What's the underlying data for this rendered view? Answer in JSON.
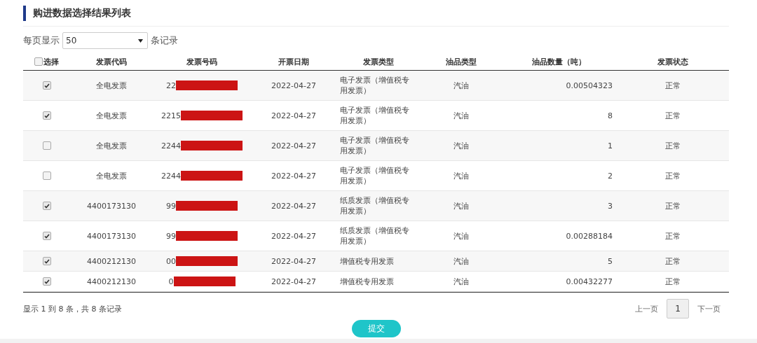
{
  "section_title": "购进数据选择结果列表",
  "page_size": {
    "label_before": "每页显示",
    "value": "50",
    "label_after": "条记录"
  },
  "table": {
    "select_all": {
      "label": "选择",
      "checked": false
    },
    "columns": [
      "发票代码",
      "发票号码",
      "开票日期",
      "发票类型",
      "油品类型",
      "油品数量（吨）",
      "发票状态"
    ],
    "rows": [
      {
        "checked": true,
        "code": "全电发票",
        "number": "22",
        "redacted": true,
        "date": "2022-04-27",
        "type": "电子发票（增值税专用发票）",
        "oil": "汽油",
        "quantity": "0.00504323",
        "status": "正常"
      },
      {
        "checked": true,
        "code": "全电发票",
        "number": "2215",
        "redacted": true,
        "date": "2022-04-27",
        "type": "电子发票（增值税专用发票）",
        "oil": "汽油",
        "quantity": "8",
        "status": "正常"
      },
      {
        "checked": false,
        "code": "全电发票",
        "number": "2244",
        "redacted": true,
        "date": "2022-04-27",
        "type": "电子发票（增值税专用发票）",
        "oil": "汽油",
        "quantity": "1",
        "status": "正常"
      },
      {
        "checked": false,
        "code": "全电发票",
        "number": "2244",
        "redacted": true,
        "date": "2022-04-27",
        "type": "电子发票（增值税专用发票）",
        "oil": "汽油",
        "quantity": "2",
        "status": "正常"
      },
      {
        "checked": true,
        "code": "4400173130",
        "number": "99",
        "redacted": true,
        "date": "2022-04-27",
        "type": "纸质发票（增值税专用发票）",
        "oil": "汽油",
        "quantity": "3",
        "status": "正常"
      },
      {
        "checked": true,
        "code": "4400173130",
        "number": "99",
        "redacted": true,
        "date": "2022-04-27",
        "type": "纸质发票（增值税专用发票）",
        "oil": "汽油",
        "quantity": "0.00288184",
        "status": "正常"
      },
      {
        "checked": true,
        "code": "4400212130",
        "number": "00",
        "redacted": true,
        "date": "2022-04-27",
        "type": "增值税专用发票",
        "oil": "汽油",
        "quantity": "5",
        "status": "正常"
      },
      {
        "checked": true,
        "code": "4400212130",
        "number": "0",
        "redacted": true,
        "date": "2022-04-27",
        "type": "增值税专用发票",
        "oil": "汽油",
        "quantity": "0.00432277",
        "status": "正常"
      }
    ]
  },
  "summary": "显示 1 到 8 条，共 8 条记录",
  "pagination": {
    "prev": "上一页",
    "pages": [
      {
        "label": "1",
        "selected": true
      }
    ],
    "next": "下一页"
  },
  "submit": "提交"
}
